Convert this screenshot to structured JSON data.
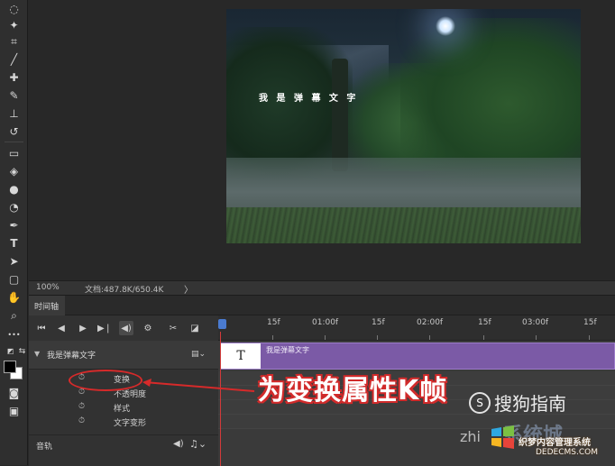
{
  "toolbar": {
    "tools": [
      {
        "name": "lasso-icon",
        "glyph": "◌"
      },
      {
        "name": "magic-wand-icon",
        "glyph": "✦"
      },
      {
        "name": "crop-icon",
        "glyph": "⌗"
      },
      {
        "name": "eyedropper-icon",
        "glyph": "╱"
      },
      {
        "name": "healing-brush-icon",
        "glyph": "✚"
      },
      {
        "name": "brush-icon",
        "glyph": "✎"
      },
      {
        "name": "clone-stamp-icon",
        "glyph": "⊥"
      },
      {
        "name": "history-brush-icon",
        "glyph": "↺"
      },
      {
        "name": "eraser-icon",
        "glyph": "▭"
      },
      {
        "name": "paint-bucket-icon",
        "glyph": "◈"
      },
      {
        "name": "blur-icon",
        "glyph": "●"
      },
      {
        "name": "dodge-icon",
        "glyph": "◔"
      },
      {
        "name": "pen-icon",
        "glyph": "✒"
      },
      {
        "name": "type-icon",
        "glyph": "T"
      },
      {
        "name": "path-select-icon",
        "glyph": "➤"
      },
      {
        "name": "shape-icon",
        "glyph": "▢"
      },
      {
        "name": "hand-icon",
        "glyph": "✋"
      },
      {
        "name": "zoom-icon",
        "glyph": "⌕"
      },
      {
        "name": "more-tools-icon",
        "glyph": "•••"
      }
    ],
    "foreground_color": "#000000",
    "background_color": "#ffffff"
  },
  "canvas": {
    "overlay_text": "我 是 弹 幕 文 字"
  },
  "statusbar": {
    "zoom": "100%",
    "doc_info": "文档:487.8K/650.4K",
    "arrow": "〉"
  },
  "timeline": {
    "tab_label": "时间轴",
    "ruler_ticks": [
      "15f",
      "01:00f",
      "15f",
      "02:00f",
      "15f",
      "03:00f",
      "15f"
    ],
    "layer_group": {
      "name": "我是弹幕文字",
      "clip_label": "我是弹幕文字",
      "clip_thumb": "T"
    },
    "properties": [
      "变换",
      "不透明度",
      "样式",
      "文字变形"
    ],
    "audio_label": "音轨",
    "controls": [
      "first-frame",
      "prev-frame",
      "play",
      "next-frame",
      "audio",
      "settings",
      "split",
      "transition"
    ]
  },
  "annotation": {
    "text": "为变换属性K帧",
    "color": "#d62a2a"
  },
  "watermarks": {
    "sogou": "搜狗指南",
    "sogou_logo": "S",
    "system_site": "系统城",
    "zhi": "zhi",
    "dede": "织梦内容管理系统",
    "url": "DEDECMS.COM"
  }
}
